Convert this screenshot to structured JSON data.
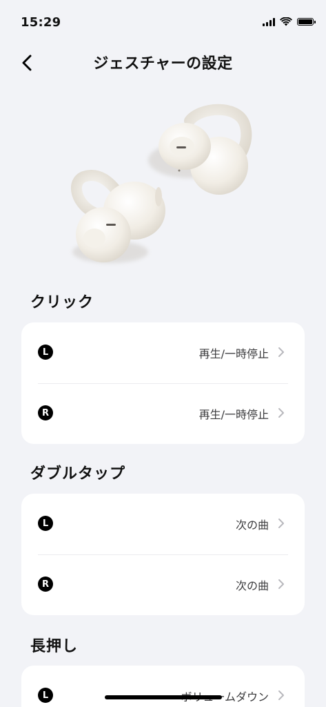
{
  "status_bar": {
    "time": "15:29"
  },
  "header": {
    "title": "ジェスチャーの設定"
  },
  "sections": [
    {
      "title": "クリック",
      "rows": [
        {
          "side": "L",
          "value": "再生/一時停止"
        },
        {
          "side": "R",
          "value": "再生/一時停止"
        }
      ]
    },
    {
      "title": "ダブルタップ",
      "rows": [
        {
          "side": "L",
          "value": "次の曲"
        },
        {
          "side": "R",
          "value": "次の曲"
        }
      ]
    },
    {
      "title": "長押し",
      "rows": [
        {
          "side": "L",
          "value": "ボリュームダウン"
        }
      ]
    }
  ],
  "icons": {
    "back": "chevron-left-icon",
    "row_arrow": "chevron-right-icon",
    "signal": "cellular-signal-icon",
    "wifi": "wifi-icon",
    "battery": "battery-icon"
  }
}
